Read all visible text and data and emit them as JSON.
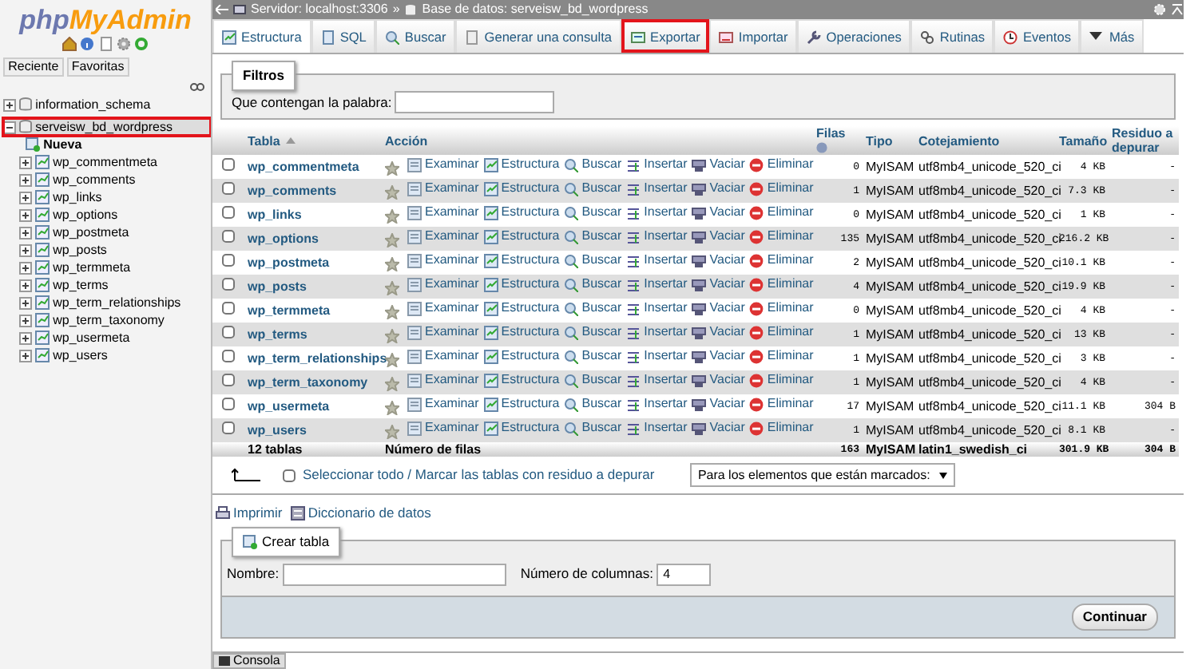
{
  "sidebar": {
    "logo": [
      "php",
      "MyAdmin"
    ],
    "tabs": [
      "Reciente",
      "Favoritas"
    ],
    "tree": [
      {
        "label": "information_schema",
        "expanded": false,
        "highlighted": false
      },
      {
        "label": "serveisw_bd_wordpress",
        "expanded": true,
        "highlighted": true,
        "children": [
          {
            "label": "Nueva",
            "kind": "new"
          },
          {
            "label": "wp_commentmeta",
            "kind": "table"
          },
          {
            "label": "wp_comments",
            "kind": "table"
          },
          {
            "label": "wp_links",
            "kind": "table"
          },
          {
            "label": "wp_options",
            "kind": "table"
          },
          {
            "label": "wp_postmeta",
            "kind": "table"
          },
          {
            "label": "wp_posts",
            "kind": "table"
          },
          {
            "label": "wp_termmeta",
            "kind": "table"
          },
          {
            "label": "wp_terms",
            "kind": "table"
          },
          {
            "label": "wp_term_relationships",
            "kind": "table"
          },
          {
            "label": "wp_term_taxonomy",
            "kind": "table"
          },
          {
            "label": "wp_usermeta",
            "kind": "table"
          },
          {
            "label": "wp_users",
            "kind": "table"
          }
        ]
      }
    ]
  },
  "breadcrumb": [
    "Servidor: localhost:3306",
    "»",
    "Base de datos: serveisw_bd_wordpress"
  ],
  "tabs": [
    {
      "label": "Estructura",
      "selected": true,
      "highlighted": false
    },
    {
      "label": "SQL",
      "selected": false,
      "highlighted": false
    },
    {
      "label": "Buscar",
      "selected": false,
      "highlighted": false
    },
    {
      "label": "Generar una consulta",
      "selected": false,
      "highlighted": false
    },
    {
      "label": "Exportar",
      "selected": false,
      "highlighted": true
    },
    {
      "label": "Importar",
      "selected": false,
      "highlighted": false
    },
    {
      "label": "Operaciones",
      "selected": false,
      "highlighted": false
    },
    {
      "label": "Rutinas",
      "selected": false,
      "highlighted": false
    },
    {
      "label": "Eventos",
      "selected": false,
      "highlighted": false
    },
    {
      "label": "Más",
      "selected": false,
      "highlighted": false
    }
  ],
  "filter": {
    "legend": "Filtros",
    "label": "Que contengan la palabra:"
  },
  "table": {
    "columns": [
      "Tabla",
      "Acción",
      "Filas",
      "Tipo",
      "Cotejamiento",
      "Tamaño",
      "Residuo a depurar"
    ],
    "rows": [
      {
        "checked": false,
        "name": "wp_commentmeta",
        "actions": [
          "Examinar",
          "Estructura",
          "Buscar",
          "Insertar",
          "Vaciar",
          "Eliminar"
        ],
        "rows": "0",
        "type": "MyISAM",
        "collation": "utf8mb4_unicode_520_ci",
        "size": "4 KB",
        "overhead": "-"
      },
      {
        "checked": false,
        "name": "wp_comments",
        "actions": [
          "Examinar",
          "Estructura",
          "Buscar",
          "Insertar",
          "Vaciar",
          "Eliminar"
        ],
        "rows": "1",
        "type": "MyISAM",
        "collation": "utf8mb4_unicode_520_ci",
        "size": "7.3 KB",
        "overhead": "-"
      },
      {
        "checked": false,
        "name": "wp_links",
        "actions": [
          "Examinar",
          "Estructura",
          "Buscar",
          "Insertar",
          "Vaciar",
          "Eliminar"
        ],
        "rows": "0",
        "type": "MyISAM",
        "collation": "utf8mb4_unicode_520_ci",
        "size": "1 KB",
        "overhead": "-"
      },
      {
        "checked": false,
        "name": "wp_options",
        "actions": [
          "Examinar",
          "Estructura",
          "Buscar",
          "Insertar",
          "Vaciar",
          "Eliminar"
        ],
        "rows": "135",
        "type": "MyISAM",
        "collation": "utf8mb4_unicode_520_ci",
        "size": "216.2 KB",
        "overhead": "-"
      },
      {
        "checked": false,
        "name": "wp_postmeta",
        "actions": [
          "Examinar",
          "Estructura",
          "Buscar",
          "Insertar",
          "Vaciar",
          "Eliminar"
        ],
        "rows": "2",
        "type": "MyISAM",
        "collation": "utf8mb4_unicode_520_ci",
        "size": "10.1 KB",
        "overhead": "-"
      },
      {
        "checked": false,
        "name": "wp_posts",
        "actions": [
          "Examinar",
          "Estructura",
          "Buscar",
          "Insertar",
          "Vaciar",
          "Eliminar"
        ],
        "rows": "4",
        "type": "MyISAM",
        "collation": "utf8mb4_unicode_520_ci",
        "size": "19.9 KB",
        "overhead": "-"
      },
      {
        "checked": false,
        "name": "wp_termmeta",
        "actions": [
          "Examinar",
          "Estructura",
          "Buscar",
          "Insertar",
          "Vaciar",
          "Eliminar"
        ],
        "rows": "0",
        "type": "MyISAM",
        "collation": "utf8mb4_unicode_520_ci",
        "size": "4 KB",
        "overhead": "-"
      },
      {
        "checked": false,
        "name": "wp_terms",
        "actions": [
          "Examinar",
          "Estructura",
          "Buscar",
          "Insertar",
          "Vaciar",
          "Eliminar"
        ],
        "rows": "1",
        "type": "MyISAM",
        "collation": "utf8mb4_unicode_520_ci",
        "size": "13 KB",
        "overhead": "-"
      },
      {
        "checked": false,
        "name": "wp_term_relationships",
        "actions": [
          "Examinar",
          "Estructura",
          "Buscar",
          "Insertar",
          "Vaciar",
          "Eliminar"
        ],
        "rows": "1",
        "type": "MyISAM",
        "collation": "utf8mb4_unicode_520_ci",
        "size": "3 KB",
        "overhead": "-"
      },
      {
        "checked": false,
        "name": "wp_term_taxonomy",
        "actions": [
          "Examinar",
          "Estructura",
          "Buscar",
          "Insertar",
          "Vaciar",
          "Eliminar"
        ],
        "rows": "1",
        "type": "MyISAM",
        "collation": "utf8mb4_unicode_520_ci",
        "size": "4 KB",
        "overhead": "-"
      },
      {
        "checked": false,
        "name": "wp_usermeta",
        "actions": [
          "Examinar",
          "Estructura",
          "Buscar",
          "Insertar",
          "Vaciar",
          "Eliminar"
        ],
        "rows": "17",
        "type": "MyISAM",
        "collation": "utf8mb4_unicode_520_ci",
        "size": "11.1 KB",
        "overhead": "304 B"
      },
      {
        "checked": false,
        "name": "wp_users",
        "actions": [
          "Examinar",
          "Estructura",
          "Buscar",
          "Insertar",
          "Vaciar",
          "Eliminar"
        ],
        "rows": "1",
        "type": "MyISAM",
        "collation": "utf8mb4_unicode_520_ci",
        "size": "8.1 KB",
        "overhead": "-"
      }
    ],
    "footer": [
      "12 tablas",
      "Número de filas",
      "163",
      "MyISAM",
      "latin1_swedish_ci",
      "301.9 KB",
      "304 B"
    ]
  },
  "bulk": {
    "checked": false,
    "label": "Seleccionar todo / Marcar las tablas con residuo a depurar",
    "select": "Para los elementos que están marcados:"
  },
  "links": [
    "Imprimir",
    "Diccionario de datos"
  ],
  "create": {
    "legend": "Crear tabla",
    "name_label": "Nombre:",
    "columns_label": "Número de columnas:",
    "columns_value": "4",
    "button": "Continuar"
  },
  "console": "Consola"
}
